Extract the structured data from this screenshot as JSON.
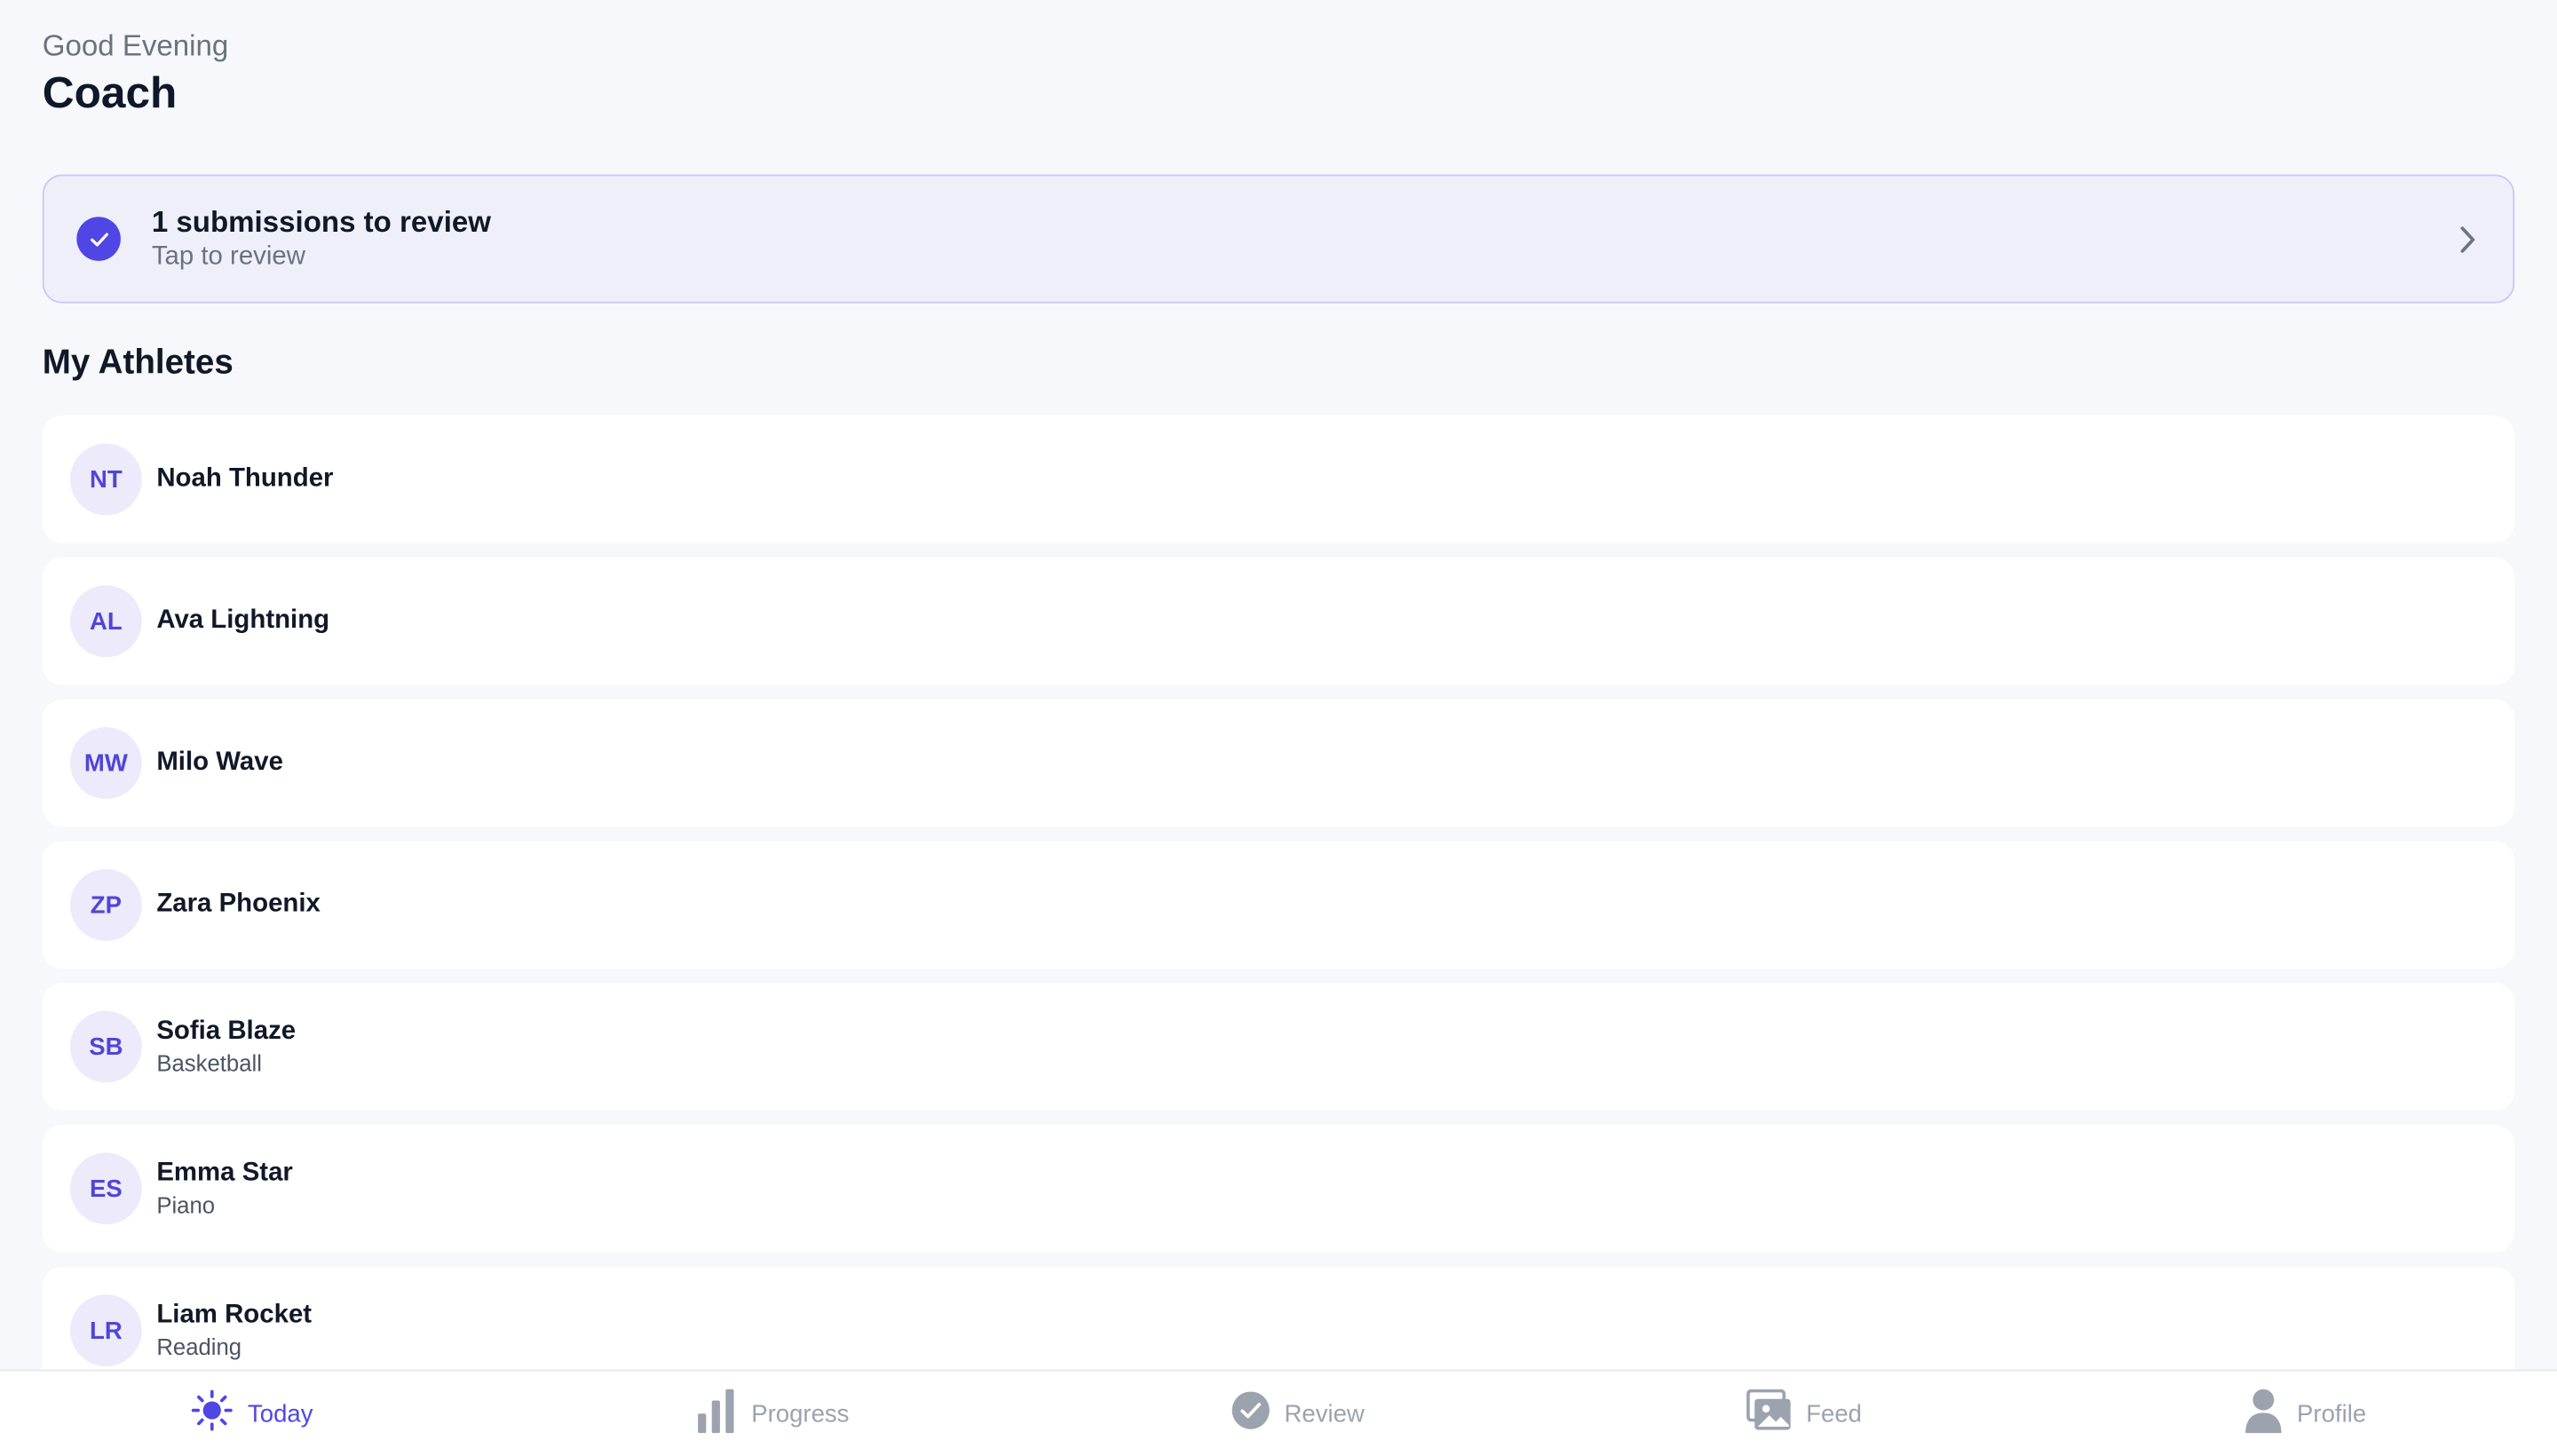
{
  "header": {
    "greeting": "Good Evening",
    "name": "Coach"
  },
  "review_banner": {
    "title": "1 submissions to review",
    "subtitle": "Tap to review"
  },
  "athletes_section": {
    "title": "My Athletes",
    "items": [
      {
        "initials": "NT",
        "name": "Noah Thunder",
        "sport": ""
      },
      {
        "initials": "AL",
        "name": "Ava Lightning",
        "sport": ""
      },
      {
        "initials": "MW",
        "name": "Milo Wave",
        "sport": ""
      },
      {
        "initials": "ZP",
        "name": "Zara Phoenix",
        "sport": ""
      },
      {
        "initials": "SB",
        "name": "Sofia Blaze",
        "sport": "Basketball"
      },
      {
        "initials": "ES",
        "name": "Emma Star",
        "sport": "Piano"
      },
      {
        "initials": "LR",
        "name": "Liam Rocket",
        "sport": "Reading"
      }
    ]
  },
  "tabbar": {
    "tabs": [
      {
        "label": "Today",
        "icon": "sun-icon",
        "active": true
      },
      {
        "label": "Progress",
        "icon": "bar-chart-icon",
        "active": false
      },
      {
        "label": "Review",
        "icon": "check-circle-icon",
        "active": false
      },
      {
        "label": "Feed",
        "icon": "image-icon",
        "active": false
      },
      {
        "label": "Profile",
        "icon": "person-icon",
        "active": false
      }
    ]
  },
  "colors": {
    "accent": "#4f46e5",
    "banner_bg": "#efeffa",
    "inactive_tab": "#9ca3af"
  }
}
